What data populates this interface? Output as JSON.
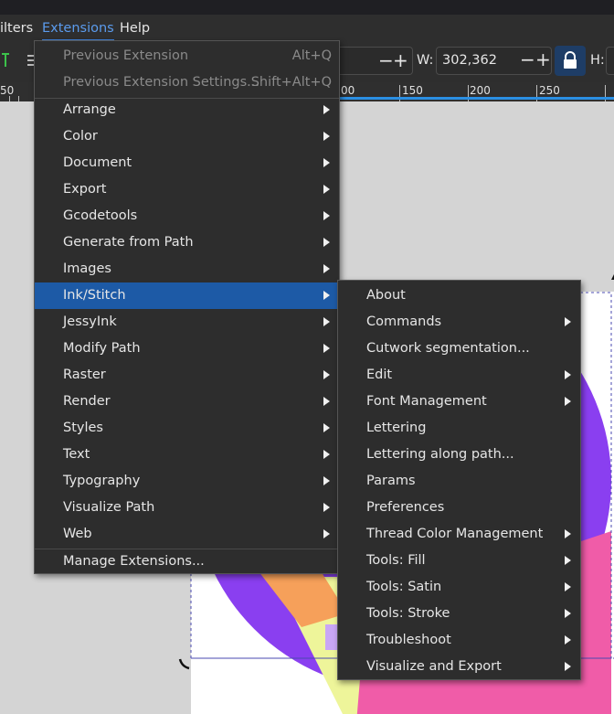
{
  "menubar": {
    "items": [
      {
        "label": "ilters"
      },
      {
        "label": "Extensions"
      },
      {
        "label": "Help"
      }
    ]
  },
  "toolbar": {
    "w_label": "W:",
    "w_value": "302,362",
    "h_label": "H:",
    "minus": "−",
    "plus": "+"
  },
  "ruler": {
    "labels": [
      "50",
      "00",
      "150",
      "200",
      "250"
    ]
  },
  "extensions_menu": {
    "items": [
      {
        "label": "Previous Extension",
        "shortcut": "Alt+Q",
        "disabled": true
      },
      {
        "label": "Previous Extension Settings...",
        "shortcut": "Shift+Alt+Q",
        "disabled": true
      },
      {
        "label": "Arrange",
        "submenu": true
      },
      {
        "label": "Color",
        "submenu": true
      },
      {
        "label": "Document",
        "submenu": true
      },
      {
        "label": "Export",
        "submenu": true
      },
      {
        "label": "Gcodetools",
        "submenu": true
      },
      {
        "label": "Generate from Path",
        "submenu": true
      },
      {
        "label": "Images",
        "submenu": true
      },
      {
        "label": "Ink/Stitch",
        "submenu": true,
        "highlighted": true
      },
      {
        "label": "JessyInk",
        "submenu": true
      },
      {
        "label": "Modify Path",
        "submenu": true
      },
      {
        "label": "Raster",
        "submenu": true
      },
      {
        "label": "Render",
        "submenu": true
      },
      {
        "label": "Styles",
        "submenu": true
      },
      {
        "label": "Text",
        "submenu": true
      },
      {
        "label": "Typography",
        "submenu": true
      },
      {
        "label": "Visualize Path",
        "submenu": true
      },
      {
        "label": "Web",
        "submenu": true
      },
      {
        "label": "Manage Extensions...",
        "submenu": false
      }
    ]
  },
  "inkstitch_menu": {
    "items": [
      {
        "label": "About",
        "submenu": false
      },
      {
        "label": "Commands",
        "submenu": true
      },
      {
        "label": "Cutwork segmentation...",
        "submenu": false
      },
      {
        "label": "Edit",
        "submenu": true
      },
      {
        "label": "Font Management",
        "submenu": true
      },
      {
        "label": "Lettering",
        "submenu": false
      },
      {
        "label": "Lettering along path...",
        "submenu": false
      },
      {
        "label": "Params",
        "submenu": false
      },
      {
        "label": "Preferences",
        "submenu": false
      },
      {
        "label": "Thread Color Management",
        "submenu": true
      },
      {
        "label": "Tools: Fill",
        "submenu": true
      },
      {
        "label": "Tools: Satin",
        "submenu": true
      },
      {
        "label": "Tools: Stroke",
        "submenu": true
      },
      {
        "label": "Troubleshoot",
        "submenu": true
      },
      {
        "label": "Visualize and Export",
        "submenu": true
      }
    ]
  },
  "colors": {
    "highlight": "#1d5aa6",
    "accent": "#5b9bec",
    "purple": "#8a3ff0",
    "pink": "#f05ca8",
    "yellow": "#eef59a",
    "orange": "#f6a05a"
  }
}
